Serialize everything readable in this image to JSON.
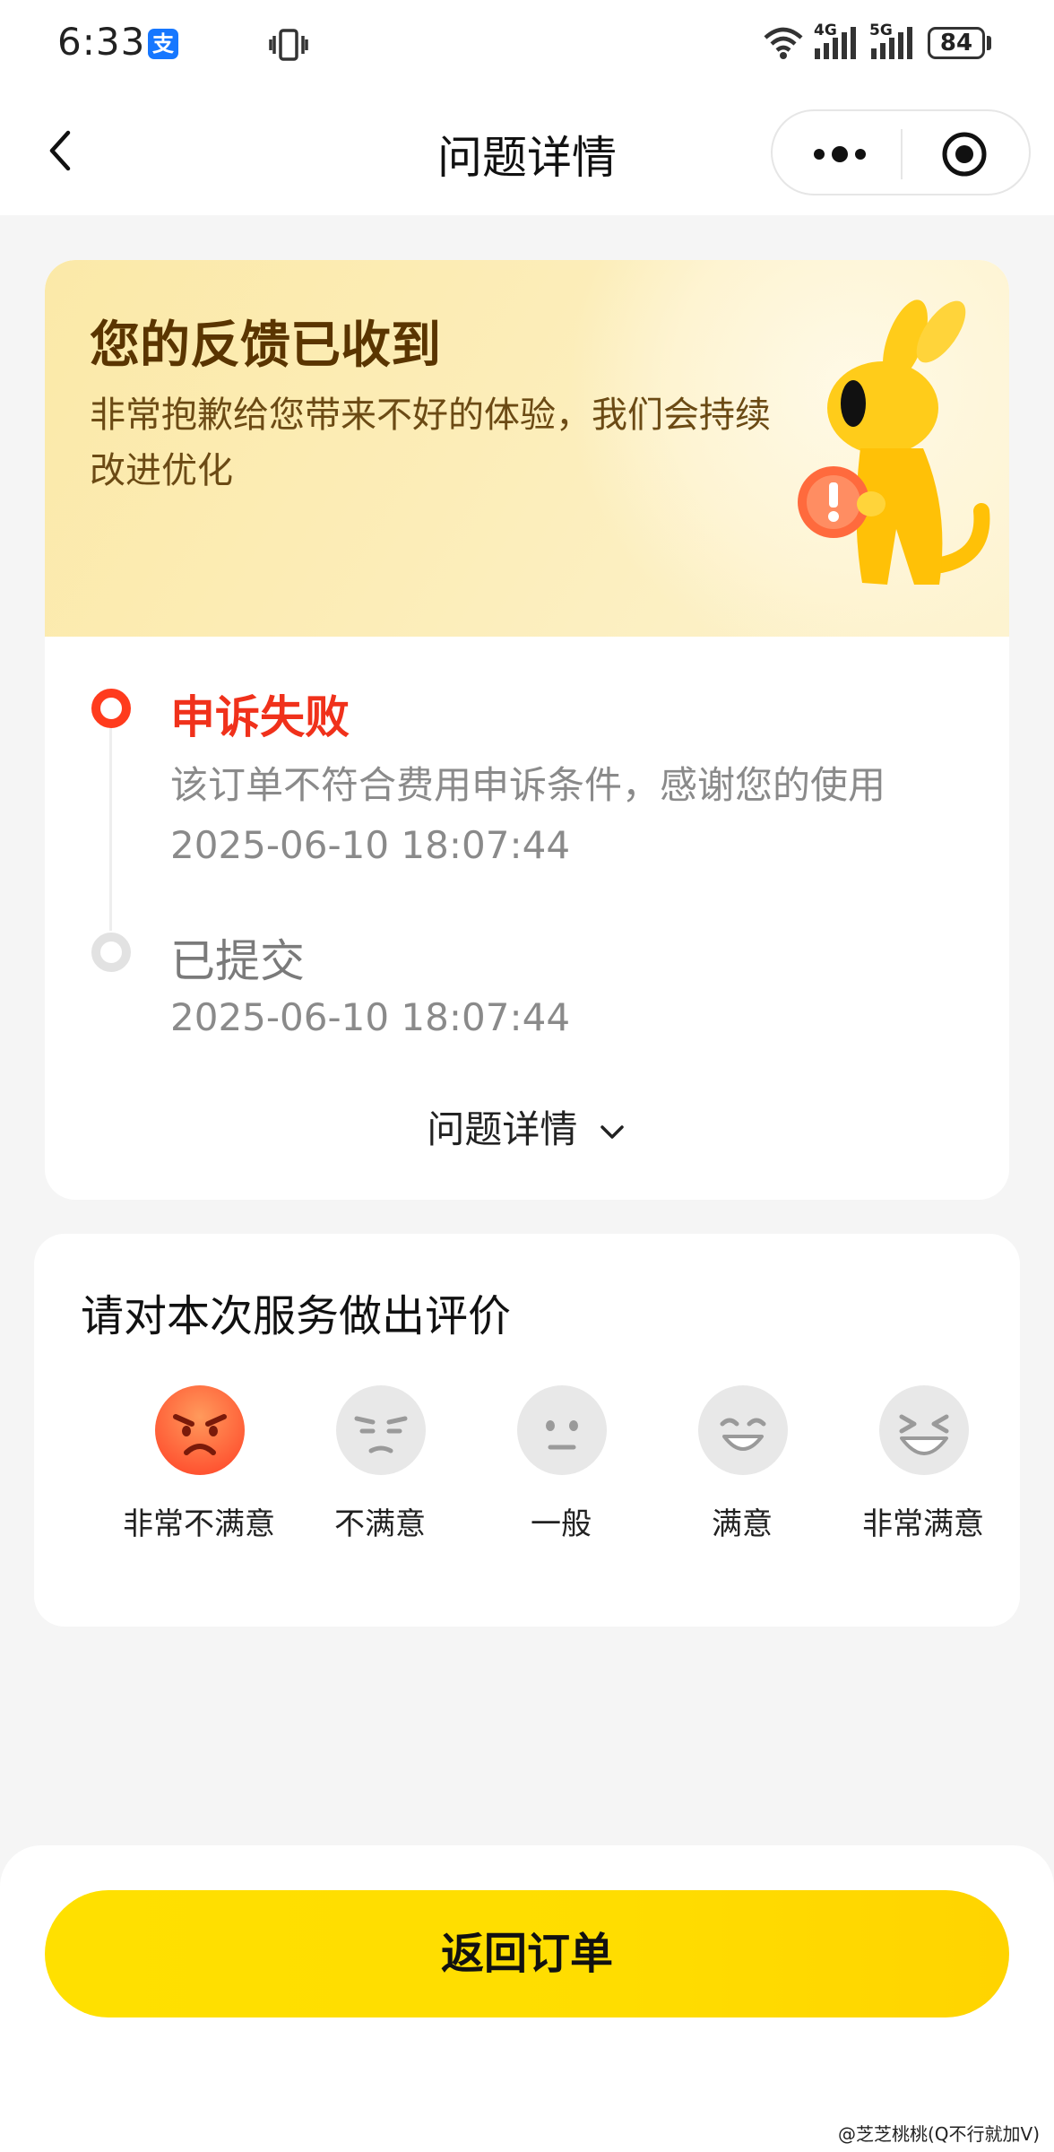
{
  "status_bar": {
    "time": "6:33",
    "alipay_badge": "支",
    "net_tag_1": "4G",
    "net_tag_2": "5G",
    "battery": "84"
  },
  "nav": {
    "title": "问题详情"
  },
  "feedback_banner": {
    "title": "您的反馈已收到",
    "subtitle": "非常抱歉给您带来不好的体验，我们会持续改进优化"
  },
  "timeline": {
    "steps": [
      {
        "title": "申诉失败",
        "description": "该订单不符合费用申诉条件，感谢您的使用",
        "time": "2025-06-10 18:07:44",
        "status": "active"
      },
      {
        "title": "已提交",
        "time": "2025-06-10 18:07:44",
        "status": "done"
      }
    ],
    "details_toggle": "问题详情"
  },
  "rating": {
    "title": "请对本次服务做出评价",
    "options": [
      {
        "label": "非常不满意",
        "icon": "angry-face-icon",
        "selected": true
      },
      {
        "label": "不满意",
        "icon": "frown-face-icon",
        "selected": false
      },
      {
        "label": "一般",
        "icon": "neutral-face-icon",
        "selected": false
      },
      {
        "label": "满意",
        "icon": "smile-face-icon",
        "selected": false
      },
      {
        "label": "非常满意",
        "icon": "laugh-face-icon",
        "selected": false
      }
    ]
  },
  "bottom": {
    "return_button": "返回订单"
  },
  "watermark": "@芝芝桃桃(Q不行就加V)",
  "colors": {
    "accent_yellow": "#ffdd00",
    "alert_red": "#f0311b",
    "banner_bg": "#fbe9a8",
    "angry_face": "#ff6a3d",
    "inactive_face": "#e8e8e8"
  }
}
